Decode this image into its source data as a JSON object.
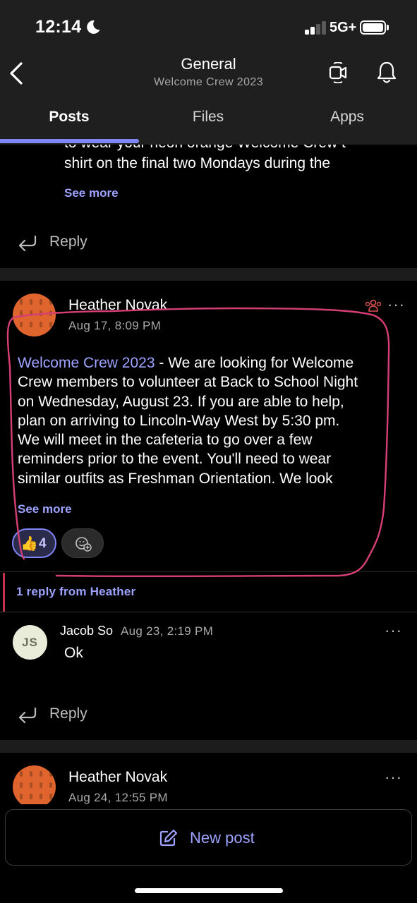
{
  "status_bar": {
    "time": "12:14",
    "network": "5G+"
  },
  "header": {
    "title": "General",
    "subtitle": "Welcome Crew 2023"
  },
  "tabs": [
    {
      "label": "Posts"
    },
    {
      "label": "Files"
    },
    {
      "label": "Apps"
    }
  ],
  "previous_post": {
    "visible_text_line1": "to wear your neon orange Welcome Crew t-",
    "visible_text_line2": "shirt on the final two Mondays during the",
    "see_more": "See more",
    "reply_label": "Reply"
  },
  "post": {
    "author": "Heather Novak",
    "timestamp": "Aug 17, 8:09 PM",
    "channel_mention": "Welcome Crew 2023",
    "body_lines": [
      " - We are looking for Welcome",
      "Crew members to volunteer at Back to School Night",
      "on Wednesday, August 23.  If you are able to help,",
      "plan on arriving to Lincoln-Way West by 5:30 pm.",
      "We will meet in the cafeteria to go over a few",
      "reminders prior to the event.  You'll need to wear",
      "similar outfits as Freshman Orientation.  We look"
    ],
    "see_more": "See more",
    "reaction": {
      "emoji": "👍",
      "count": "4"
    },
    "more_menu": "···"
  },
  "replies": {
    "summary": "1 reply from Heather",
    "items": [
      {
        "initials": "JS",
        "author": "Jacob So",
        "timestamp": "Aug 23, 2:19 PM",
        "message": "Ok",
        "more_menu": "···"
      }
    ],
    "reply_label": "Reply"
  },
  "next_post": {
    "author": "Heather Novak",
    "timestamp": "Aug 24, 12:55 PM",
    "more_menu": "···"
  },
  "new_post": {
    "label": "New post"
  },
  "colors": {
    "accent": "#7f85f5",
    "link": "#9da3ff",
    "annotation": "#d63f75",
    "avatar": "#e0642e",
    "reply_accent": "#c4314b"
  }
}
